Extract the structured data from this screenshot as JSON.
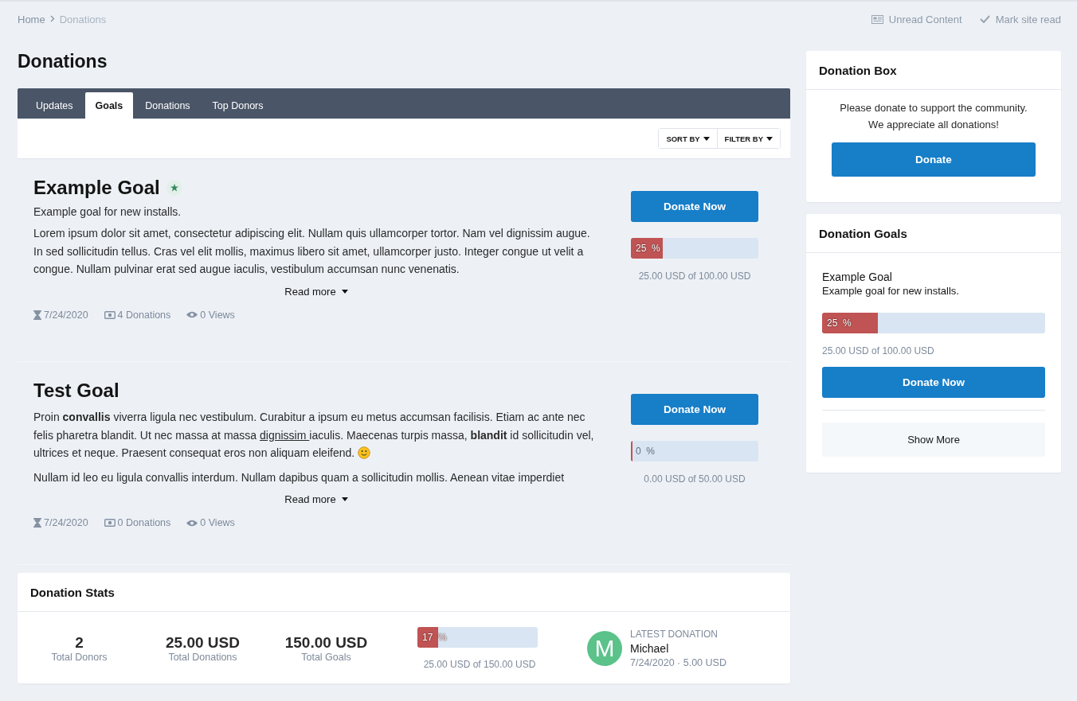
{
  "breadcrumb": [
    {
      "label": "Home"
    },
    {
      "label": "Donations"
    }
  ],
  "header_links": [
    {
      "kind": "unread",
      "label": "Unread Content"
    },
    {
      "kind": "mark",
      "label": "Mark site read"
    }
  ],
  "title": "Donations",
  "tabs": [
    {
      "label": "Updates",
      "selected": false
    },
    {
      "label": "Goals",
      "selected": true
    },
    {
      "label": "Donations",
      "selected": false
    },
    {
      "label": "Top Donors",
      "selected": false
    }
  ],
  "sort_buttons": [
    "SORT BY",
    "FILTER BY"
  ],
  "goals": [
    {
      "title": "Example Goal",
      "featured": true,
      "summary": "Example goal for new installs.",
      "paragraphs": [
        [
          {
            "kind": "text",
            "text": "Lorem ipsum dolor sit amet, consectetur adipiscing elit. Nullam quis ullamcorper tortor. Nam vel dignissim augue. In sed sollicitudin tellus. Cras vel elit mollis, maximus libero sit amet, ullamcorper justo. Integer congue ut velit a congue. Nullam pulvinar erat sed augue iaculis, vestibulum accumsan nunc venenatis."
          }
        ]
      ],
      "read_more": "Read more",
      "date": "7/24/2020",
      "donations": "4 Donations",
      "views": "0 Views",
      "donate": "Donate Now",
      "level": 0.25,
      "percent": "25  %",
      "amount": "25.00 USD of 100.00 USD"
    },
    {
      "title": "Test Goal",
      "featured": false,
      "paragraphs": [
        [
          {
            "kind": "text",
            "text": "Proin "
          },
          {
            "kind": "bold",
            "text": "convallis"
          },
          {
            "kind": "text",
            "text": " viverra ligula nec vestibulum. Curabitur a ipsum eu metus accumsan facilisis. Etiam ac ante nec felis pharetra blandit. Ut nec massa at massa "
          },
          {
            "kind": "link",
            "text": "dignissim "
          },
          {
            "kind": "text",
            "text": "iaculis. Maecenas turpis massa, "
          },
          {
            "kind": "bold",
            "text": "blandit"
          },
          {
            "kind": "text",
            "text": " id sollicitudin vel, ultrices et neque. Praesent consequat eros non aliquam eleifend. "
          },
          {
            "kind": "smiley"
          }
        ],
        [
          {
            "kind": "text",
            "text": "Nullam id leo eu ligula convallis interdum. Nullam dapibus quam a sollicitudin mollis. Aenean vitae imperdiet"
          }
        ]
      ],
      "read_more": "Read more",
      "date": "7/24/2020",
      "donations": "0 Donations",
      "views": "0 Views",
      "donate": "Donate Now",
      "level": 0,
      "percent": "0  %",
      "amount": "0.00 USD of 50.00 USD"
    }
  ],
  "stats": {
    "title": "Donation Stats",
    "items": [
      {
        "value": "2",
        "label": "Total Donors"
      },
      {
        "value": "25.00 USD",
        "label": "Total Donations"
      },
      {
        "value": "150.00 USD",
        "label": "Total Goals"
      }
    ],
    "level": 0.17,
    "percent": "17  %",
    "amount": "25.00 USD of 150.00 USD",
    "latest": {
      "avatar": "M",
      "label": "LATEST DONATION",
      "name": "Michael",
      "detail": "7/24/2020 · 5.00 USD"
    }
  },
  "donation_box": {
    "title": "Donation Box",
    "text": [
      "Please donate to support the community.",
      "We appreciate all donations!"
    ],
    "button": "Donate"
  },
  "donation_goals": {
    "title": "Donation Goals",
    "goal": {
      "title": "Example Goal",
      "summary": "Example goal for new installs.",
      "level": 0.25,
      "percent": "25  %",
      "amount": "25.00 USD of 100.00 USD",
      "button": "Donate Now"
    },
    "show_more": "Show More"
  }
}
